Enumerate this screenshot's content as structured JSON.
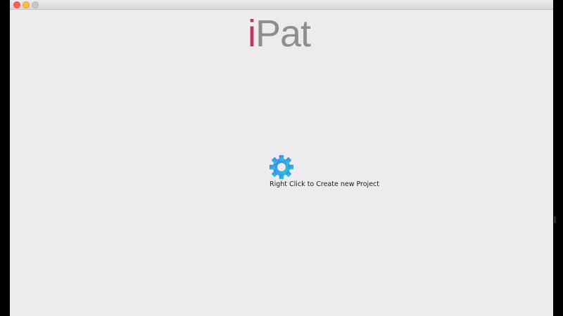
{
  "app": {
    "logo_i": "i",
    "logo_rest": "Pat"
  },
  "main": {
    "hint_text": "Right Click to Create new Project",
    "gear_icon": "gear-icon"
  },
  "colors": {
    "logo_i": "#c0365a",
    "logo_rest": "#8e8e8e",
    "background": "#edebee",
    "gear_top": "#3a8df2",
    "gear_bottom": "#35d6a6"
  }
}
